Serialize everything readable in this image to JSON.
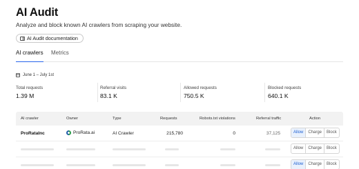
{
  "header": {
    "title": "AI Audit",
    "subtitle": "Analyze and block known AI crawlers from scraping your website.",
    "doc_button_label": "AI Audit documentation"
  },
  "tabs": [
    {
      "label": "AI crawlers",
      "active": true
    },
    {
      "label": "Metrics",
      "active": false
    }
  ],
  "date_range": "June 1 – July 1st",
  "stats": [
    {
      "label": "Total requests",
      "value": "1.39 M"
    },
    {
      "label": "Referral visits",
      "value": "83.1 K"
    },
    {
      "label": "Allowed requests",
      "value": "750.5 K"
    },
    {
      "label": "Blocked requests",
      "value": "640.1 K"
    }
  ],
  "table": {
    "columns": [
      "AI crawler",
      "Owner",
      "Type",
      "Requests",
      "Robots.txt violations",
      "Referral traffic",
      "Action"
    ],
    "rows": [
      {
        "crawler": "ProRataInc",
        "owner": "ProRata.ai",
        "owner_logo": "prorata-logo-icon",
        "type": "AI Crawler",
        "requests": "215,780",
        "violations": "0",
        "referral": "37,125",
        "action": "Allow"
      }
    ],
    "action_options": [
      "Allow",
      "Charge",
      "Block"
    ]
  },
  "colors": {
    "accent": "#2563eb",
    "active_action_bg": "#e9f1fd",
    "active_action_text": "#1d5fd1"
  }
}
